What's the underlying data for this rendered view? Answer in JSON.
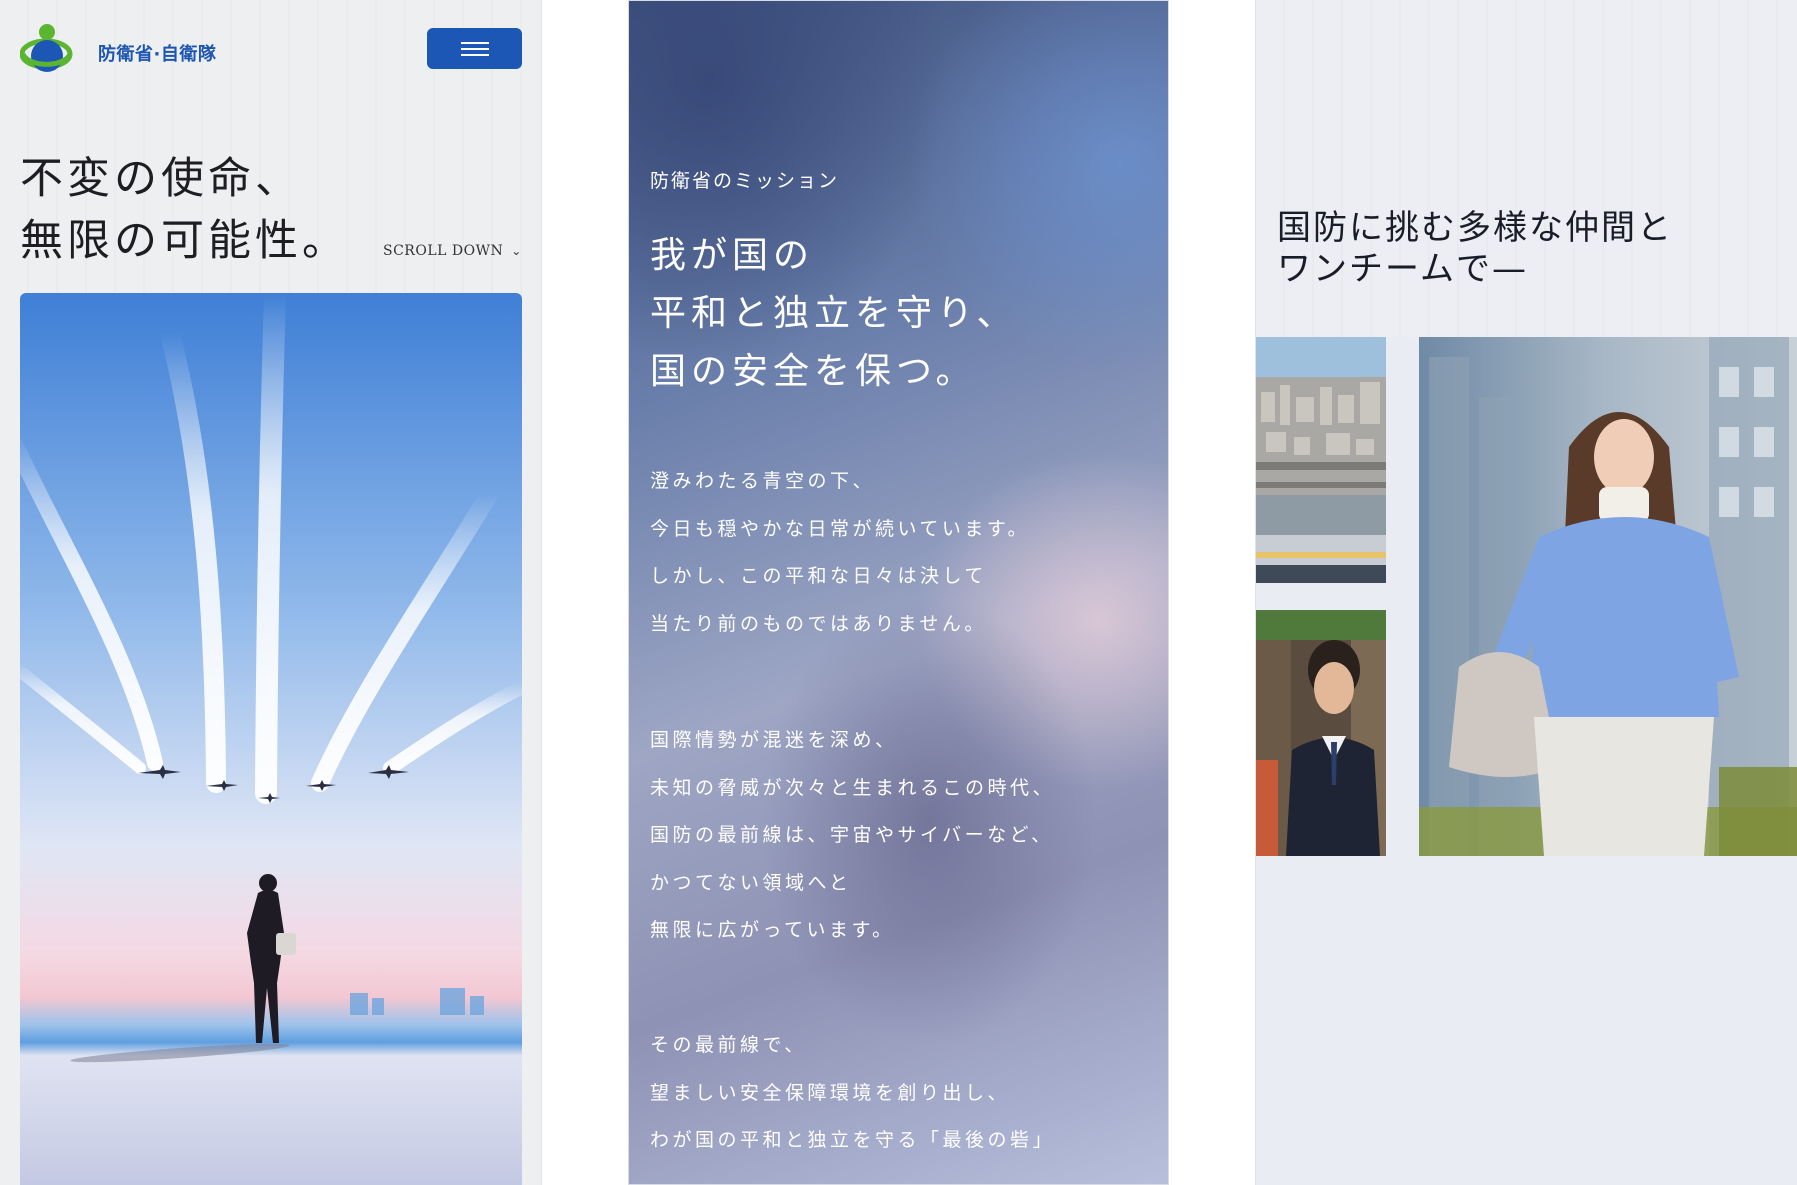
{
  "header": {
    "logo_text": "防衛省·自衛隊",
    "menu_icon": "hamburger-icon"
  },
  "hero": {
    "title_lines": [
      "不変の使命、",
      "無限の可能性。"
    ],
    "scroll_label": "SCROLL DOWN",
    "scroll_icon": "chevron-down-icon"
  },
  "mission": {
    "label": "防衛省のミッション",
    "heading_lines": [
      "我が国の",
      "平和と独立を守り、",
      "国の安全を保つ。"
    ],
    "paragraphs": [
      [
        "澄みわたる青空の下、",
        "今日も穏やかな日常が続いています。",
        "しかし、この平和な日々は決して",
        "当たり前のものではありません。"
      ],
      [
        "国際情勢が混迷を深め、",
        "未知の脅威が次々と生まれるこの時代、",
        "国防の最前線は、宇宙やサイバーなど、",
        "かつてない領域へと",
        "無限に広がっています。"
      ],
      [
        "その最前線で、",
        "望ましい安全保障環境を創り出し、",
        "わが国の平和と独立を守る「最後の砦」"
      ]
    ]
  },
  "team": {
    "heading_lines": [
      "国防に挑む多様な仲間と",
      "ワンチームで—"
    ]
  },
  "colors": {
    "brand_blue": "#1c57b5",
    "logo_green": "#5bb531",
    "text_dark": "#1d1d22"
  }
}
